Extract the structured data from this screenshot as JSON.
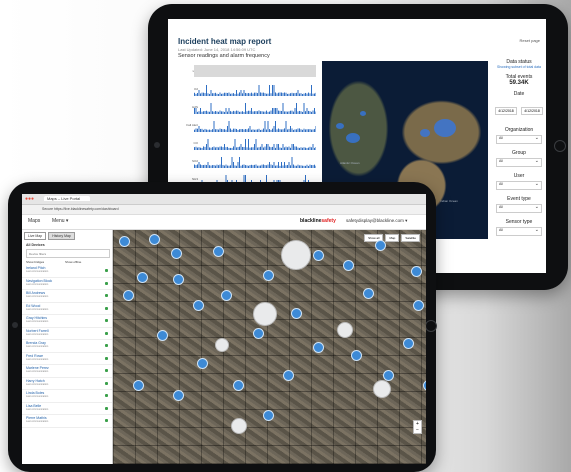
{
  "report": {
    "title": "Incident heat map report",
    "last_updated": "Last Updated: June 14, 2018 14:56:09 UTC",
    "subtitle": "Sensor readings and alarm frequency",
    "reset_label": "Reset page",
    "sensors": [
      "LEL",
      "O2",
      "H2S",
      "Fall Alert",
      "CO",
      "SO2",
      "NH3"
    ],
    "map": {
      "ocean_labels": [
        "Atlantic Ocean",
        "Indian Ocean"
      ]
    },
    "sidebar": {
      "data_status_label": "Data status",
      "data_status_link": "Showing subset of total data",
      "total_events_label": "Total events",
      "total_events_value": "59.34K",
      "date_label": "Date",
      "date_from": "4/12/2018",
      "date_to": "4/12/2018",
      "filters": [
        {
          "label": "Organization",
          "value": "All"
        },
        {
          "label": "Group",
          "value": "All"
        },
        {
          "label": "User",
          "value": "All"
        },
        {
          "label": "Event type",
          "value": "All"
        },
        {
          "label": "Sensor type",
          "value": "All"
        }
      ]
    }
  },
  "browser": {
    "tab_title": "Maps – Live Portal",
    "url": "Secure  https://live.blacklinesafety.com/dashboard"
  },
  "app": {
    "nav_maps": "Maps",
    "nav_menu": "Menu ▾",
    "logo_prefix": "blackline",
    "logo_suffix": "safety",
    "user_email": "safetydisplay@blackline.com ▾"
  },
  "device_panel": {
    "tab_live": "Live Map",
    "tab_history": "History Map",
    "all_devices": "All Devices",
    "search_placeholder": "Device filters",
    "show_bridges": "Show bridges",
    "show_offline": "Show offline",
    "devices": [
      {
        "name": "Ireland Pitch",
        "status": "Last communication"
      },
      {
        "name": "Navigation Block",
        "status": "Last communication"
      },
      {
        "name": "Bill Andrews",
        "status": "Last communication"
      },
      {
        "name": "Ed Wood",
        "status": "Last communication"
      },
      {
        "name": "Gray Hitchins",
        "status": "Last communication"
      },
      {
        "name": "Norbert Farrell",
        "status": "Last communication"
      },
      {
        "name": "Brenda Gray",
        "status": "Last communication"
      },
      {
        "name": "Fred Rowe",
        "status": "Last communication"
      },
      {
        "name": "Marlene Perez",
        "status": "Last communication"
      },
      {
        "name": "Harry Hatch",
        "status": "Last communication"
      },
      {
        "name": "Linda Boles",
        "status": "Last communication"
      },
      {
        "name": "Lisa Belle",
        "status": "Last communication"
      },
      {
        "name": "Pierre Mathis",
        "status": "Last communication"
      }
    ]
  },
  "map_tools": {
    "show_all": "Show all",
    "map": "Map",
    "satellite": "Satellite"
  }
}
